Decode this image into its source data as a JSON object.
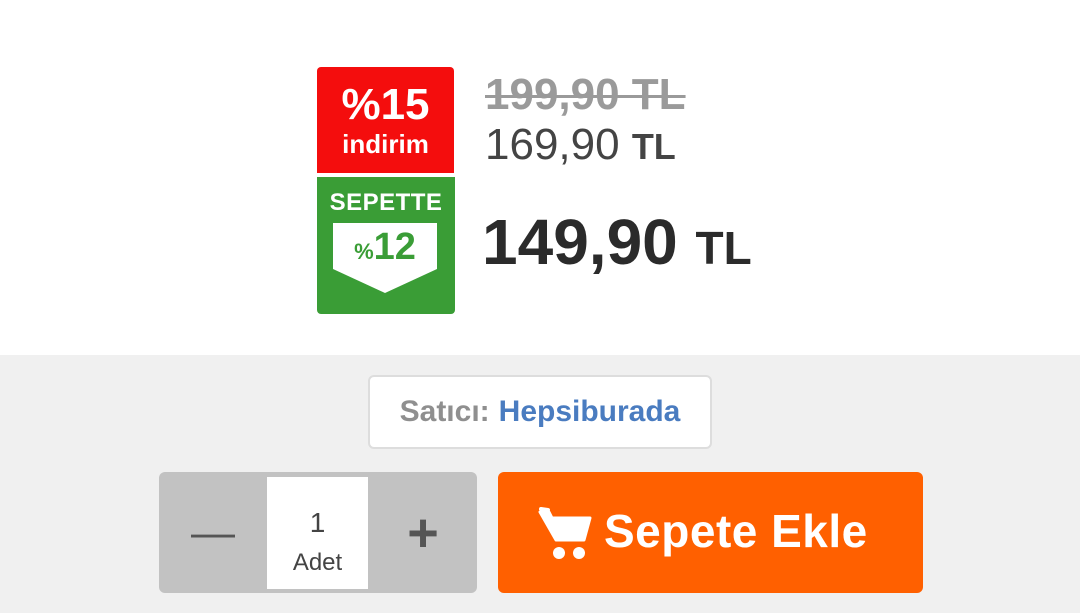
{
  "pricing": {
    "discount_badge": {
      "percent": "%15",
      "word": "indirim"
    },
    "basket_badge": {
      "label": "SEPETTE",
      "percent_sign": "%",
      "percent_value": "12"
    },
    "original_price": "199,90 TL",
    "discounted_price": {
      "amount": "169,90",
      "currency": "TL"
    },
    "basket_price": {
      "amount": "149,90",
      "currency": "TL"
    }
  },
  "seller": {
    "label": "Satıcı:",
    "name": "Hepsiburada"
  },
  "quantity": {
    "minus": "—",
    "value": "1",
    "unit": "Adet",
    "plus": "+"
  },
  "add_to_cart": {
    "label": "Sepete Ekle",
    "icon": "cart-icon"
  },
  "colors": {
    "discount_red": "#f40d0d",
    "basket_green": "#3a9d36",
    "seller_blue": "#4a7cc0",
    "cta_orange": "#ff6000"
  }
}
